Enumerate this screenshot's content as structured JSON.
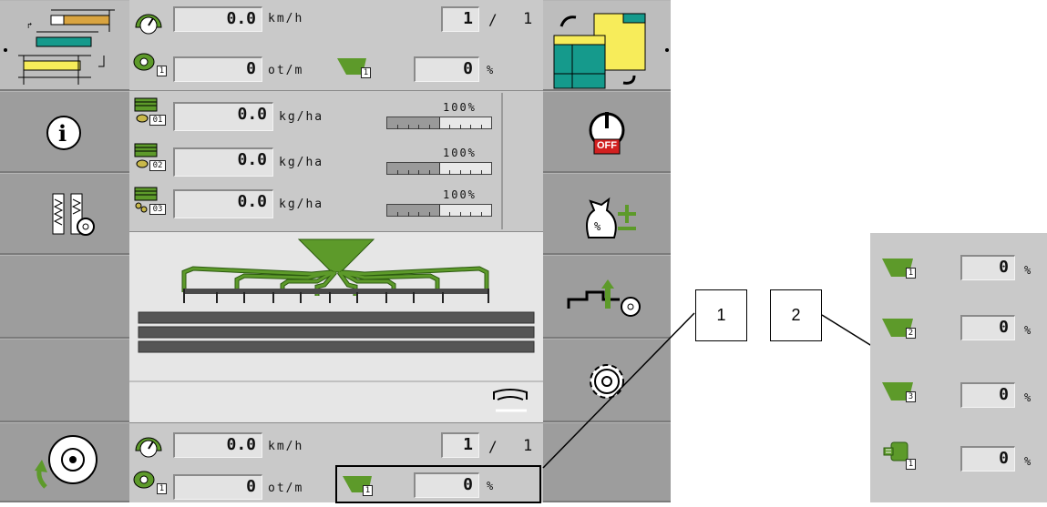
{
  "status_top": {
    "speed_value": "0.0",
    "speed_unit": "km/h",
    "section_left": "1",
    "section_sep": "/",
    "section_right": "1",
    "rpm_sub": "1",
    "rpm_value": "0",
    "rpm_unit": "ot/m",
    "hopper_sub": "1",
    "hopper_value": "0",
    "hopper_unit": "%"
  },
  "metering": [
    {
      "sub": "01",
      "value": "0.0",
      "unit": "kg/ha",
      "pct": "100%",
      "fill": 0.5
    },
    {
      "sub": "02",
      "value": "0.0",
      "unit": "kg/ha",
      "pct": "100%",
      "fill": 0.5
    },
    {
      "sub": "03",
      "value": "0.0",
      "unit": "kg/ha",
      "pct": "100%",
      "fill": 0.5
    }
  ],
  "status_bottom": {
    "speed_value": "0.0",
    "speed_unit": "km/h",
    "section_left": "1",
    "section_sep": "/",
    "section_right": "1",
    "rpm_sub": "1",
    "rpm_value": "0",
    "rpm_unit": "ot/m",
    "hopper_sub": "1",
    "hopper_value": "0",
    "hopper_unit": "%"
  },
  "callouts": {
    "one": "1",
    "two": "2"
  },
  "side_panel": [
    {
      "sub": "1",
      "value": "0",
      "unit": "%",
      "icon": "hopper-icon"
    },
    {
      "sub": "2",
      "value": "0",
      "unit": "%",
      "icon": "hopper-icon"
    },
    {
      "sub": "3",
      "value": "0",
      "unit": "%",
      "icon": "hopper-icon"
    },
    {
      "sub": "1",
      "value": "0",
      "unit": "%",
      "icon": "microgranulator-icon"
    }
  ],
  "off_badge": "OFF",
  "colors": {
    "green": "#5d9a2a",
    "teal": "#159a8c",
    "yellow": "#f7ec5a",
    "off_red": "#d22020"
  }
}
